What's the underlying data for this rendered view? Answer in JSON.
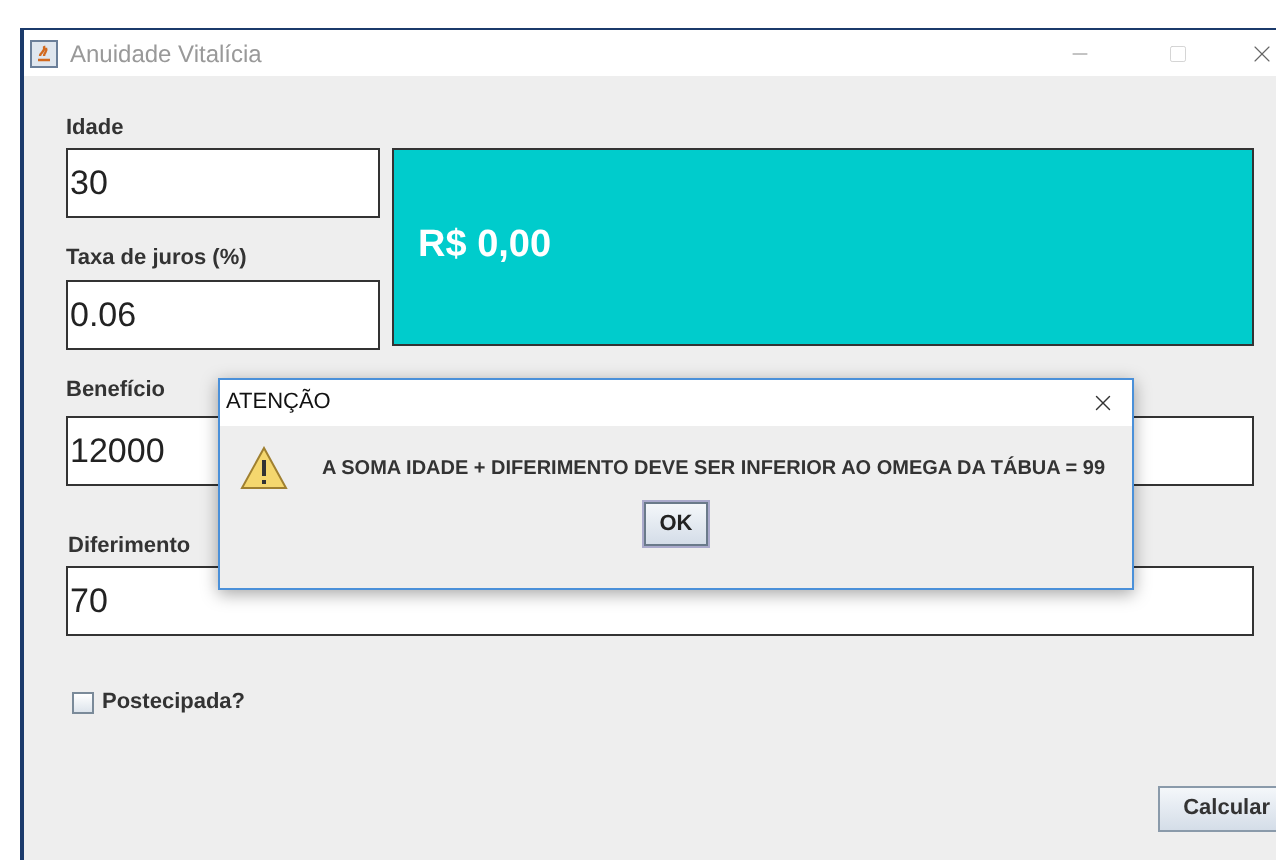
{
  "window": {
    "title": "Anuidade Vitalícia"
  },
  "fields": [
    {
      "label": "Idade",
      "value": "30"
    },
    {
      "label": "Taxa de juros (%)",
      "value": "0.06"
    },
    {
      "label": "Benefício",
      "value": "12000"
    },
    {
      "label": "Diferimento",
      "value": "70"
    }
  ],
  "result": {
    "text": "R$ 0,00"
  },
  "checkbox": {
    "label": "Postecipada?",
    "checked": false
  },
  "button": {
    "label": "Calcular"
  },
  "dialog": {
    "title": "ATENÇÃO",
    "message": "A SOMA IDADE + DIFERIMENTO DEVE SER INFERIOR AO OMEGA DA TÁBUA = 99",
    "button": "OK"
  }
}
